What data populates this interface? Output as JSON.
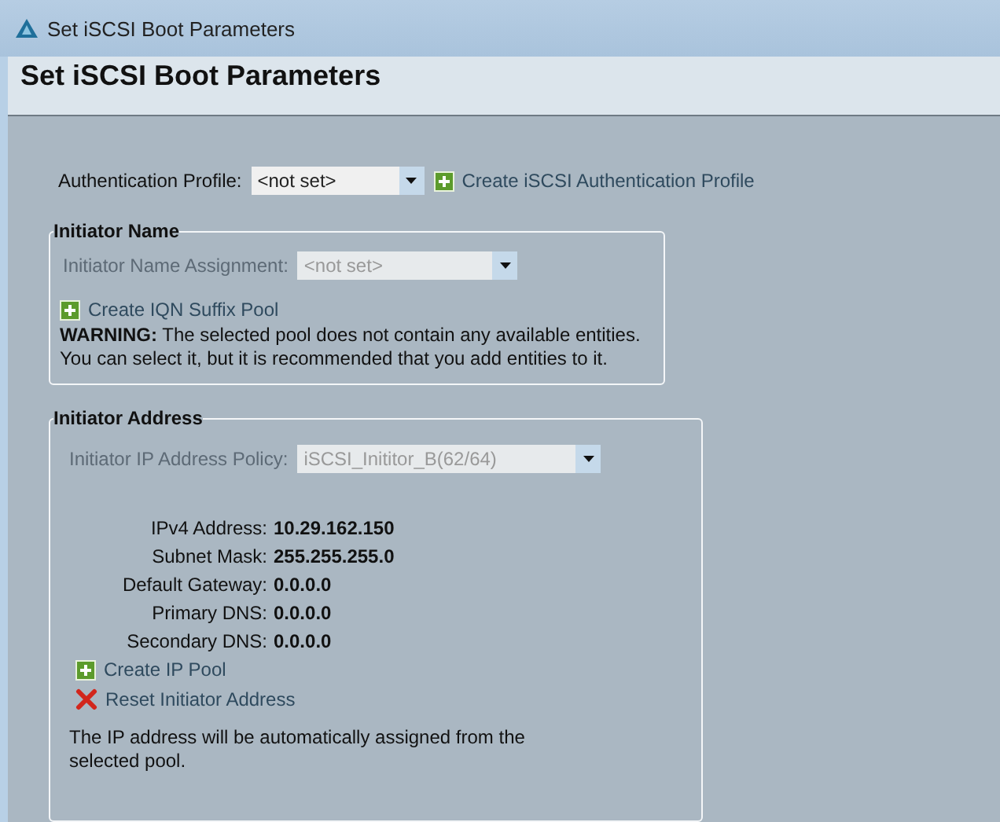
{
  "window": {
    "title": "Set iSCSI Boot Parameters"
  },
  "header": {
    "title": "Set iSCSI Boot Parameters"
  },
  "authentication": {
    "label": "Authentication Profile:",
    "value": "<not set>",
    "disabled": false,
    "action": {
      "kind": "add",
      "label": "Create iSCSI Authentication Profile"
    }
  },
  "initiator_name": {
    "legend": "Initiator Name",
    "assignment": {
      "label": "Initiator Name Assignment:",
      "value": "<not set>",
      "disabled": true
    },
    "actions": [
      {
        "kind": "add",
        "label": "Create IQN Suffix Pool"
      }
    ],
    "warning": "**WARNING:** The selected pool does not contain any available entities. You can select it, but it is recommended that you add entities to it."
  },
  "initiator_address": {
    "legend": "Initiator Address",
    "policy": {
      "label": "Initiator IP Address Policy:",
      "value": "iSCSI_Inititor_B(62/64)",
      "disabled": true
    },
    "fields": [
      {
        "label": "IPv4 Address:",
        "value": "10.29.162.150"
      },
      {
        "label": "Subnet Mask:",
        "value": "255.255.255.0"
      },
      {
        "label": "Default Gateway:",
        "value": "0.0.0.0"
      },
      {
        "label": "Primary DNS:",
        "value": "0.0.0.0"
      },
      {
        "label": "Secondary DNS:",
        "value": "0.0.0.0"
      }
    ],
    "actions": [
      {
        "kind": "add",
        "label": "Create IP Pool"
      },
      {
        "kind": "remove",
        "label": "Reset Initiator Address"
      }
    ],
    "note": "The IP address will be automatically assigned from the selected pool."
  }
}
